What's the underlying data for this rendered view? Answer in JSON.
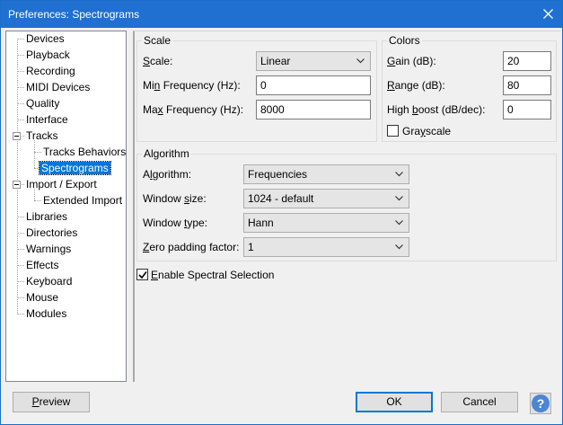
{
  "window": {
    "title": "Preferences: Spectrograms"
  },
  "tree": {
    "items": [
      {
        "label": "Devices"
      },
      {
        "label": "Playback"
      },
      {
        "label": "Recording"
      },
      {
        "label": "MIDI Devices"
      },
      {
        "label": "Quality"
      },
      {
        "label": "Interface"
      },
      {
        "label": "Tracks"
      },
      {
        "label": "Tracks Behaviors"
      },
      {
        "label": "Spectrograms"
      },
      {
        "label": "Import / Export"
      },
      {
        "label": "Extended Import"
      },
      {
        "label": "Libraries"
      },
      {
        "label": "Directories"
      },
      {
        "label": "Warnings"
      },
      {
        "label": "Effects"
      },
      {
        "label": "Keyboard"
      },
      {
        "label": "Mouse"
      },
      {
        "label": "Modules"
      }
    ],
    "selected": "Spectrograms"
  },
  "scale": {
    "group_title": "Scale",
    "scale_label_pre": "",
    "scale_label_u": "S",
    "scale_label_post": "cale:",
    "scale_value": "Linear",
    "min_label_pre": "Mi",
    "min_label_u": "n",
    "min_label_post": " Frequency (Hz):",
    "min_value": "0",
    "max_label_pre": "Ma",
    "max_label_u": "x",
    "max_label_post": " Frequency (Hz):",
    "max_value": "8000"
  },
  "colors": {
    "group_title": "Colors",
    "gain_label_pre": "",
    "gain_label_u": "G",
    "gain_label_post": "ain (dB):",
    "gain_value": "20",
    "range_label_pre": "",
    "range_label_u": "R",
    "range_label_post": "ange (dB):",
    "range_value": "80",
    "boost_label_pre": "High ",
    "boost_label_u": "b",
    "boost_label_post": "oost (dB/dec):",
    "boost_value": "0",
    "grayscale_label_pre": "Gra",
    "grayscale_label_u": "y",
    "grayscale_label_post": "scale",
    "grayscale_checked": false
  },
  "algorithm": {
    "group_title": "Algorithm",
    "alg_label_pre": "A",
    "alg_label_u": "l",
    "alg_label_post": "gorithm:",
    "alg_value": "Frequencies",
    "wsize_label_pre": "Window ",
    "wsize_label_u": "s",
    "wsize_label_post": "ize:",
    "wsize_value": "1024 - default",
    "wtype_label_pre": "Window ",
    "wtype_label_u": "t",
    "wtype_label_post": "ype:",
    "wtype_value": "Hann",
    "zero_label_pre": "",
    "zero_label_u": "Z",
    "zero_label_post": "ero padding factor:",
    "zero_value": "1"
  },
  "spectral": {
    "label_pre": "",
    "label_u": "E",
    "label_post": "nable Spectral Selection",
    "checked": true
  },
  "buttons": {
    "preview_pre": "",
    "preview_u": "P",
    "preview_post": "review",
    "ok": "OK",
    "cancel": "Cancel",
    "help": "?"
  },
  "colors_ui": {
    "titlebar": "#1f70d1",
    "selection": "#0078d7",
    "help": "#4a86d4"
  }
}
